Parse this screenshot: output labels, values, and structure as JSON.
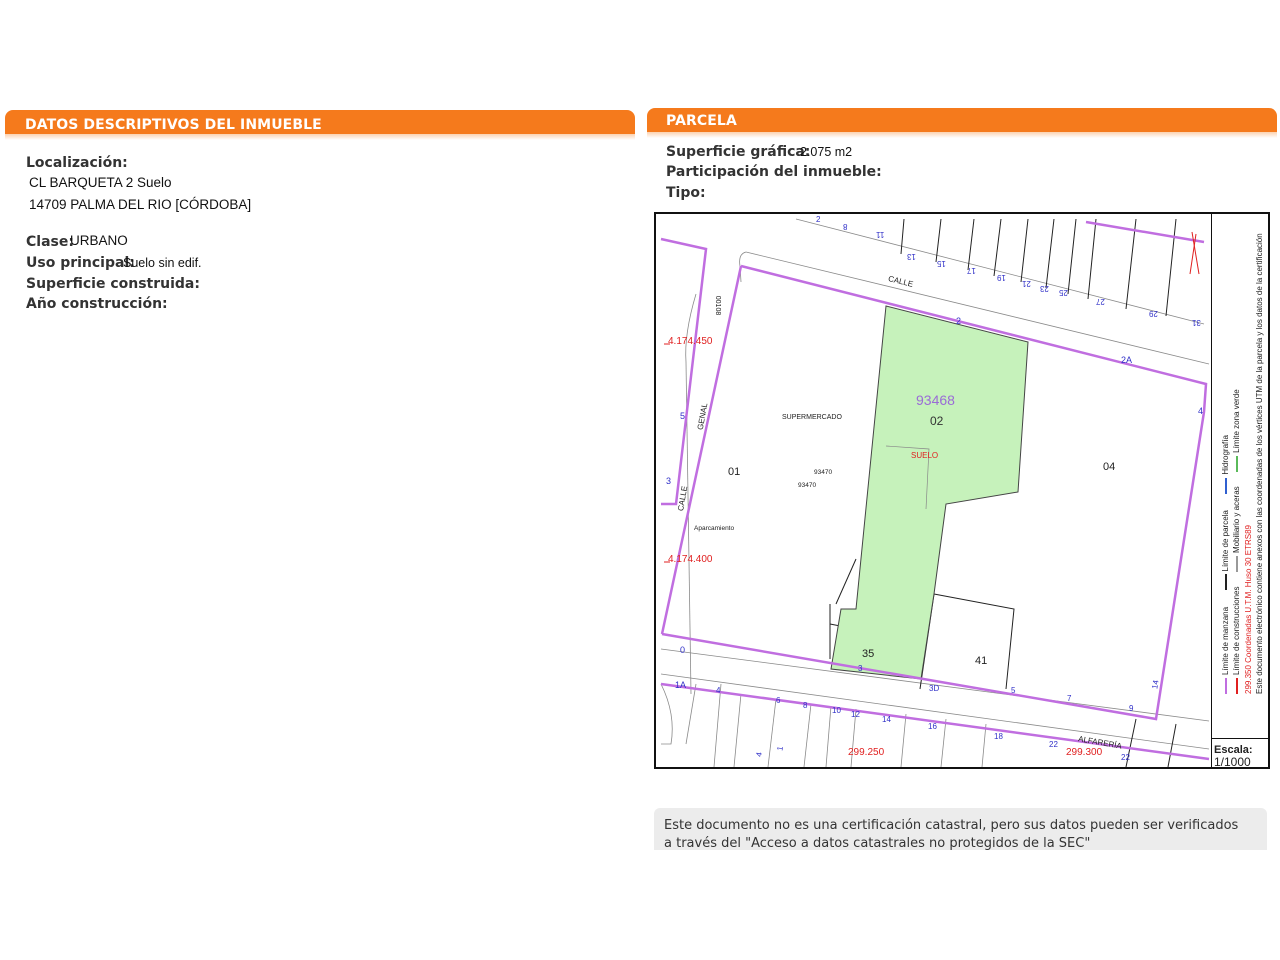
{
  "left_panel": {
    "header": "DATOS DESCRIPTIVOS DEL INMUEBLE",
    "localizacion_label": "Localización:",
    "address_line1": "CL BARQUETA 2 Suelo",
    "address_line2": "14709 PALMA DEL RIO [CÓRDOBA]",
    "clase_label": "Clase:",
    "clase_value": "URBANO",
    "uso_label": "Uso principal:",
    "uso_value": "Suelo sin edif.",
    "superficie_label": "Superficie construida:",
    "ano_label": "Año construcción:"
  },
  "right_panel": {
    "header": "PARCELA",
    "superficie_label": "Superficie gráfica:",
    "superficie_value": "2.075 m2",
    "participacion_label": "Participación del inmueble:",
    "tipo_label": "Tipo:"
  },
  "map": {
    "colors": {
      "parcel_fill": "#c6f2bb",
      "block_line": "#c06ee0",
      "number_blue": "#3030c8",
      "coord_red": "#e02020"
    },
    "parcel_id": "93468",
    "parcel_no": "02",
    "suelo_label": "SUELO",
    "block_refs": {
      "a": "93470",
      "b": "93470"
    },
    "labels": {
      "supermercado": "SUPERMERCADO",
      "aparcamiento": "Aparcamiento",
      "p01": "01",
      "p04": "04",
      "p35": "35",
      "p41": "41",
      "calle_top": "CALLE",
      "calle_left": "CALLE",
      "genal": "GENAL",
      "alfareria": "ALFARERÍA",
      "rot_00108": "00108"
    },
    "coords": {
      "y_upper": "4.174.450",
      "y_lower": "4.174.400",
      "x_left": "299.250",
      "x_right": "299.300"
    },
    "street_numbers": {
      "top_row": [
        "2",
        "8",
        "11",
        "13",
        "15",
        "17",
        "19",
        "21",
        "23",
        "25",
        "27",
        "29",
        "31"
      ],
      "two": "2",
      "two_a": "2A",
      "four": "4",
      "left_five": "5",
      "left_three": "3",
      "zero": "0",
      "one_a": "1A",
      "bottom_row": [
        "4",
        "6",
        "8",
        "10",
        "12",
        "14",
        "16",
        "18",
        "22"
      ],
      "front_row": [
        "3",
        "3D",
        "5",
        "7",
        "9",
        "14"
      ],
      "small_a": "4",
      "small_b": "1"
    },
    "legend": {
      "manzana": "Límite de manzana",
      "parcela": "Límite de parcela",
      "hidrografia": "Hidrografía",
      "construcciones": "Límite de construcciones",
      "mobiliario": "Mobiliario y aceras",
      "zona_verde": "Límite zona verde",
      "coordinates_note": "Coordenadas U.T.M. Huso 30 ETRS89",
      "coordinates_value": "299.350",
      "annex_note": "Este documento electrónico contiene anexos con las coordenadas de los vértices UTM de la parcela y los datos de la certificación"
    },
    "scale_label": "Escala:",
    "scale_value": "1/1000"
  },
  "notice": {
    "text": "Este documento no es una certificación catastral, pero sus datos pueden ser verificados a través del \"Acceso a datos catastrales no protegidos de la SEC\""
  }
}
